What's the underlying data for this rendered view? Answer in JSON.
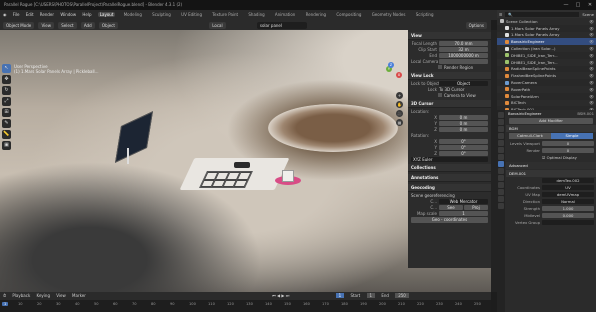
{
  "titlebar": {
    "title": "Parallel Rogue [C:\\USERS\\PHOTOS\\ParallelProject\\ParallelRogue.blend] - Blender 4.3.1 (2)",
    "minimize": "—",
    "maximize": "□",
    "close": "✕"
  },
  "menubar": {
    "file": "File",
    "edit": "Edit",
    "render": "Render",
    "window": "Window",
    "help": "Help",
    "workspaces": [
      "Layout",
      "Modeling",
      "Sculpting",
      "UV Editing",
      "Texture Paint",
      "Shading",
      "Animation",
      "Rendering",
      "Compositing",
      "Geometry Nodes",
      "Scripting"
    ],
    "active_workspace": "Layout"
  },
  "vp_header": {
    "mode": "Object Mode",
    "view": "View",
    "select": "Select",
    "add": "Add",
    "object": "Object",
    "orientation": "Local",
    "pivot": "",
    "snap": "",
    "search": "solar panel",
    "options": "Options"
  },
  "viewport_overlay": {
    "line1": "User Perspective",
    "line2": "(1) 1.Mars Solar Panels Array | Pickleball..."
  },
  "toolbar": {
    "tools": [
      "cursor",
      "move",
      "rotate",
      "scale",
      "transform",
      "annotate",
      "measure",
      "add"
    ]
  },
  "gizmo": {
    "x": "X",
    "y": "Y",
    "z": "Z"
  },
  "npanel": {
    "view_header": "View",
    "focal_length_label": "Focal Length",
    "focal_length": "70.0 mm",
    "clip_start_label": "Clip Start",
    "clip_start": "32 m",
    "clip_end_label": "End",
    "clip_end": "1000000000 m",
    "local_camera_label": "Local Camera",
    "render_region": "Render Region",
    "view_lock_header": "View Lock",
    "lock_to_object_label": "Lock to Object",
    "lock_to_object": "Object",
    "lock_label": "Lock",
    "lock_3d_cursor": "To 3D Cursor",
    "lock_camera": "Camera to View",
    "cursor_header": "3D Cursor",
    "location_label": "Location:",
    "loc_x": "0 m",
    "loc_y": "0 m",
    "loc_z": "0 m",
    "rotation_label": "Rotation:",
    "rot_x": "0°",
    "rot_y": "0°",
    "rot_z": "0°",
    "rot_mode": "XYZ Euler",
    "collections_header": "Collections",
    "annotations_header": "Annotations",
    "geocoding_header": "Geocoding",
    "scene_georef": "Scene georeferencing",
    "web_mercator": "Web Mercator",
    "c_label1": "C...",
    "c_label2": "C...",
    "see_btn": "See",
    "proj_btn": "Proj",
    "map_scale_label": "Map scale",
    "map_scale": "1",
    "geo_btn": "Geo - coordinates"
  },
  "outliner": {
    "filter": "Scene",
    "view_layer": "ViewLayer",
    "rows": [
      {
        "name": "Scene Collection",
        "color": "#bbbbbb",
        "sel": false
      },
      {
        "name": "1.Mars Solar Panels Array",
        "color": "#e0e0e0",
        "sel": false
      },
      {
        "name": "1.Mars Solar Panels Array",
        "color": "#e0e0e0",
        "sel": false
      },
      {
        "name": "BorosiricEngineer",
        "color": "#e08a3c",
        "sel": true
      },
      {
        "name": "Collection (Iran Solar...)",
        "color": "#e0e0e0",
        "sel": false
      },
      {
        "name": "DHIBE1_SIDE_Iran_Terr...",
        "color": "#9bc26b",
        "sel": false
      },
      {
        "name": "DHIBE1_SIDE_Iran_Terr...",
        "color": "#9bc26b",
        "sel": false
      },
      {
        "name": "RadialBeanSplinePoints",
        "color": "#e08a3c",
        "sel": false
      },
      {
        "name": "FlashedBeeSplinePoints",
        "color": "#e08a3c",
        "sel": false
      },
      {
        "name": "RoverCamera",
        "color": "#6b9bd1",
        "sel": false
      },
      {
        "name": "RoverPath",
        "color": "#e08a3c",
        "sel": false
      },
      {
        "name": "SolarPanelArm",
        "color": "#e08a3c",
        "sel": false
      },
      {
        "name": "BiCTech",
        "color": "#e08a3c",
        "sel": false
      },
      {
        "name": "BiCTech.001",
        "color": "#e08a3c",
        "sel": false
      }
    ]
  },
  "props": {
    "object_name": "BorosiricEngineer",
    "modifier_name": "BSM.001",
    "add_modifier": "Add Modifier",
    "mod1_name": "BGM",
    "catmull": "Catmull-Clark",
    "simple": "Simple",
    "levels_viewport_label": "Levels Viewport",
    "levels_viewport": "0",
    "render_label": "Render",
    "render_val": "0",
    "optimal_display": "Optimal Display",
    "advanced": "Advanced",
    "mod2_name": "DEM.001",
    "texture_label": "",
    "texture": "demTex.002",
    "coordinates_label": "Coordinates",
    "coordinates": "UV",
    "uv_map_label": "UV Map",
    "uv_map": "demUVmap",
    "direction_label": "Direction",
    "direction": "Normal",
    "strength_label": "Strength",
    "strength": "1.000",
    "midlevel_label": "Midlevel",
    "midlevel": "0.000",
    "vertex_group_label": "Vertex Group",
    "vertex_group": ""
  },
  "timeline": {
    "playback": "Playback",
    "keying": "Keying",
    "view": "View",
    "marker": "Marker",
    "current_frame": "1",
    "start_label": "Start",
    "start": "1",
    "end_label": "End",
    "end": "250",
    "ticks": [
      "10",
      "20",
      "30",
      "40",
      "50",
      "60",
      "70",
      "80",
      "90",
      "100",
      "110",
      "120",
      "130",
      "140",
      "150",
      "160",
      "170",
      "180",
      "190",
      "200",
      "210",
      "220",
      "230",
      "240",
      "250"
    ]
  }
}
